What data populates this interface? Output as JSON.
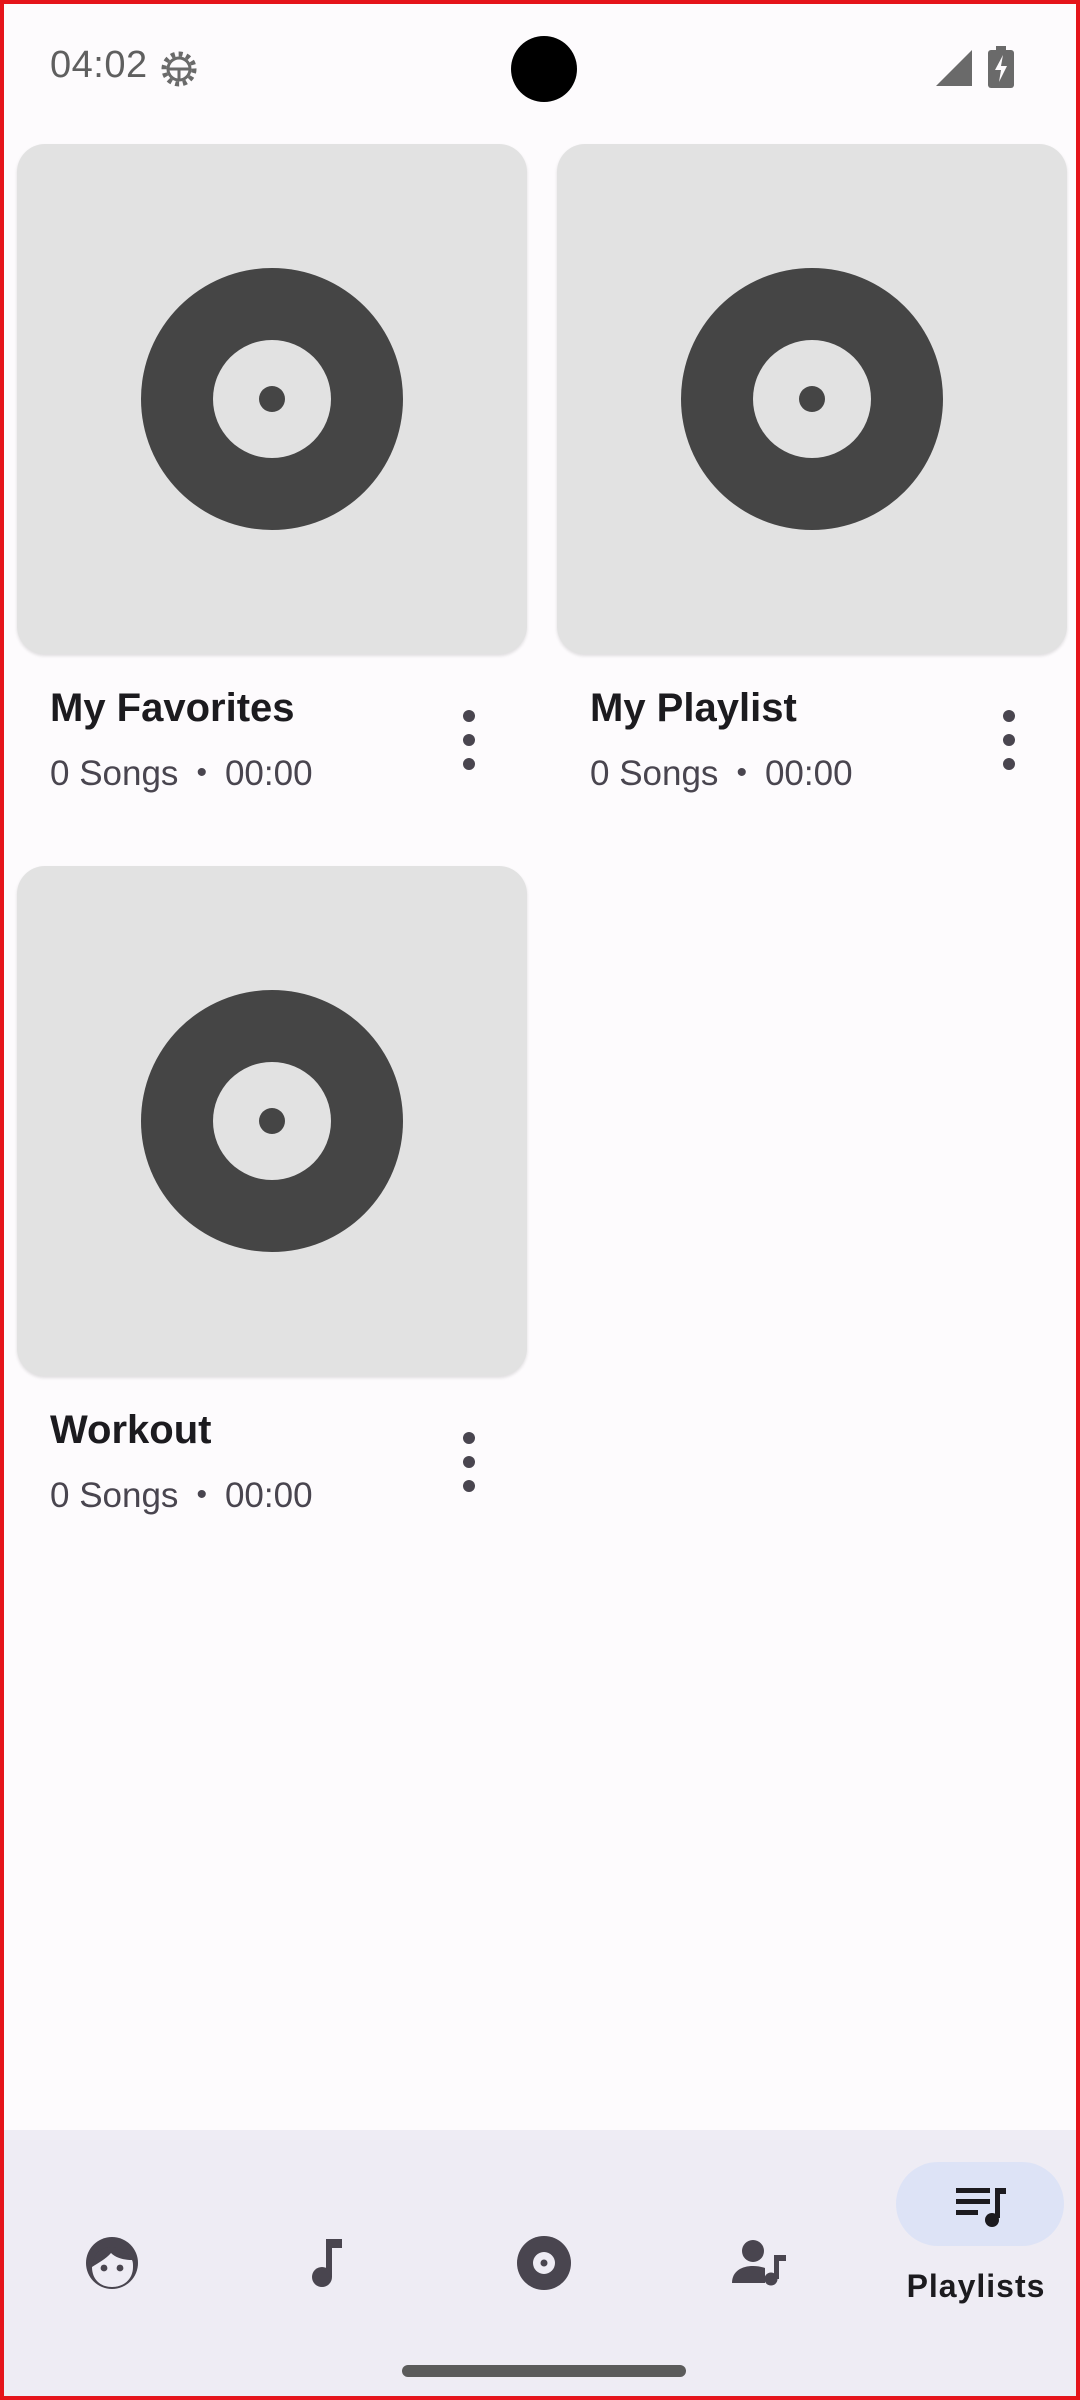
{
  "status_bar": {
    "time": "04:02"
  },
  "playlists": [
    {
      "title": "My Favorites",
      "songs": "0 Songs",
      "duration": "00:00"
    },
    {
      "title": "My Playlist",
      "songs": "0 Songs",
      "duration": "00:00"
    },
    {
      "title": "Workout",
      "songs": "0 Songs",
      "duration": "00:00"
    }
  ],
  "meta_separator": "•",
  "bottom_nav": {
    "items": [
      {
        "icon": "face-icon",
        "label": ""
      },
      {
        "icon": "music-note-icon",
        "label": ""
      },
      {
        "icon": "album-icon",
        "label": ""
      },
      {
        "icon": "artist-icon",
        "label": ""
      },
      {
        "icon": "playlist-icon",
        "label": "Playlists",
        "active": true
      }
    ]
  },
  "colors": {
    "background": "#fdfbfd",
    "art_placeholder": "#e2e2e2",
    "disc": "#454545",
    "nav_background": "#eeecf4",
    "nav_active_pill": "#dde3f6",
    "frame_border": "#e5141a"
  }
}
